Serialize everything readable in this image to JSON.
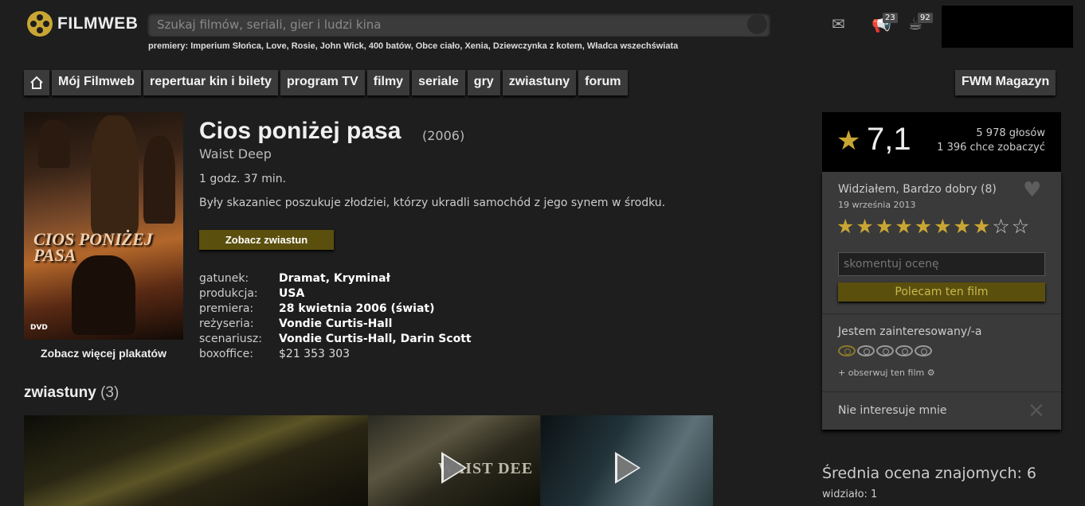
{
  "brand": {
    "name": "FILMWEB"
  },
  "search": {
    "placeholder": "Szukaj filmów, seriali, gier i ludzi kina"
  },
  "premieres": {
    "label": "premiery:",
    "items": "Imperium Słońca, Love, Rosie, John Wick, 400 batów, Obce ciało, Xenia, Dziewczynka z kotem, Władca wszechświata"
  },
  "header": {
    "notif_count": "23",
    "msg_count": "92"
  },
  "nav": {
    "items": [
      "Mój Filmweb",
      "repertuar kin i bilety",
      "program TV",
      "filmy",
      "seriale",
      "gry",
      "zwiastuny",
      "forum"
    ],
    "magazine": "FWM Magazyn"
  },
  "film": {
    "title": "Cios poniżej pasa",
    "year": "(2006)",
    "original_title": "Waist Deep",
    "duration": "1 godz. 37 min.",
    "description": "Były skazaniec poszukuje złodziei, którzy ukradli samochód z jego synem w środku.",
    "trailer_button": "Zobacz zwiastun",
    "poster_title": "CIOS PONIŻEJ PASA",
    "more_posters": "Zobacz więcej plakatów",
    "details": [
      {
        "label": "gatunek:",
        "value": "Dramat, Kryminał"
      },
      {
        "label": "produkcja:",
        "value": "USA"
      },
      {
        "label": "premiera:",
        "value": "28 kwietnia 2006 (świat)"
      },
      {
        "label": "reżyseria:",
        "value": "Vondie Curtis-Hall"
      },
      {
        "label": "scenariusz:",
        "value": "Vondie Curtis-Hall, Darin Scott"
      },
      {
        "label": "boxoffice:",
        "value": "$21 353 303"
      }
    ]
  },
  "trailers": {
    "heading": "zwiastuny",
    "count": "(3)",
    "thumb_text": "WAIST DEE"
  },
  "rating": {
    "score": "7,1",
    "votes": "5 978 głosów",
    "want": "1 396 chce zobaczyć",
    "seen": "Widziałem, Bardzo dobry (8)",
    "date": "19 września 2013",
    "user_score": 8,
    "max_score": 10,
    "comment_placeholder": "skomentuj ocenę",
    "recommend": "Polecam ten film",
    "interest": "Jestem zainteresowany/-a",
    "interest_level": 1,
    "interest_max": 5,
    "watch": "+ obserwuj ten film",
    "not_interested": "Nie interesuje mnie"
  },
  "friends": {
    "avg": "Średnia ocena znajomych: 6",
    "seen": "widziało: 1"
  },
  "colors": {
    "accent": "#c9a634",
    "button": "#5b4f0e",
    "background": "#1e1e1e"
  }
}
